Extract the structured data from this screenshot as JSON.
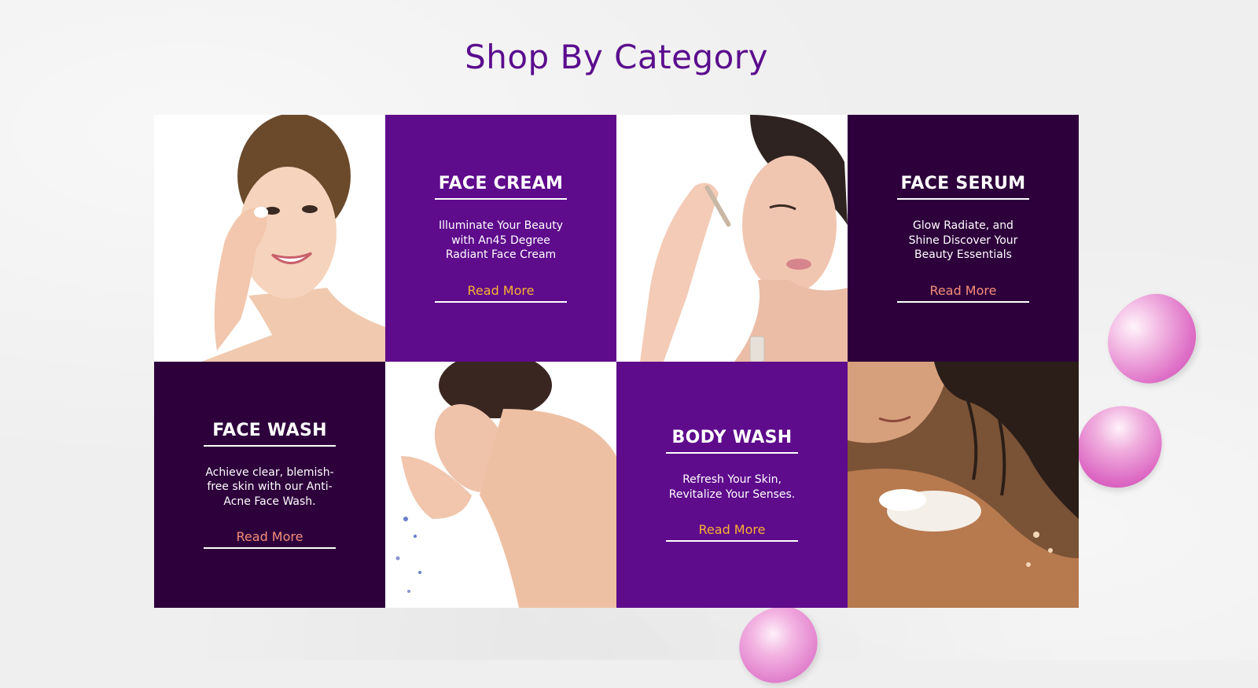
{
  "page": {
    "title": "Shop By Category"
  },
  "colors": {
    "title": "#5b0d8e",
    "purple": "#5e0b8c",
    "dark_purple": "#2d003b",
    "link_gold": "#f9b233",
    "link_coral": "#f58e7a",
    "petal_pink": "#de6fc6"
  },
  "categories": [
    {
      "title": "FACE CREAM",
      "description": "Illuminate Your Beauty with An45 Degree Radiant Face Cream",
      "link_label": "Read More",
      "tile_color": "#5e0b8c",
      "link_color": "#f9b233"
    },
    {
      "title": "FACE SERUM",
      "description": "Glow Radiate, and Shine Discover Your Beauty Essentials",
      "link_label": "Read More",
      "tile_color": "#2d003b",
      "link_color": "#f58e7a"
    },
    {
      "title": "FACE WASH",
      "description": "Achieve clear, blemish-free skin with our Anti-Acne Face Wash.",
      "link_label": "Read More",
      "tile_color": "#2d003b",
      "link_color": "#f58e7a"
    },
    {
      "title": "BODY WASH",
      "description": "Refresh Your Skin, Revitalize Your Senses.",
      "link_label": "Read More",
      "tile_color": "#5e0b8c",
      "link_color": "#f9b233"
    }
  ],
  "images": [
    {
      "name": "woman-applying-cream-image"
    },
    {
      "name": "woman-applying-serum-image"
    },
    {
      "name": "woman-washing-face-image"
    },
    {
      "name": "woman-body-wash-shoulder-image"
    }
  ]
}
